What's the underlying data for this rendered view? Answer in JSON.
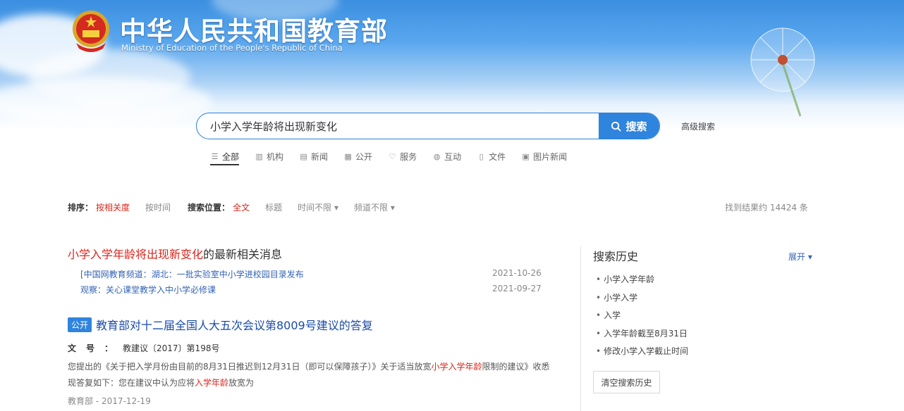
{
  "header": {
    "title_cn": "中华人民共和国教育部",
    "title_en": "Ministry of Education of the People's Republic of China",
    "logo_icon": "national-emblem-icon"
  },
  "search": {
    "value": "小学入学年龄将出现新变化",
    "button_label": "搜索",
    "advanced_label": "高级搜索"
  },
  "tabs": [
    {
      "label": "全部",
      "icon": "list-icon",
      "active": true
    },
    {
      "label": "机构",
      "icon": "building-icon",
      "active": false
    },
    {
      "label": "新闻",
      "icon": "news-icon",
      "active": false
    },
    {
      "label": "公开",
      "icon": "document-icon",
      "active": false
    },
    {
      "label": "服务",
      "icon": "heart-icon",
      "active": false
    },
    {
      "label": "互动",
      "icon": "chat-icon",
      "active": false
    },
    {
      "label": "文件",
      "icon": "file-icon",
      "active": false
    },
    {
      "label": "图片新闻",
      "icon": "image-icon",
      "active": false
    }
  ],
  "filter": {
    "sort_label": "排序：",
    "sort_relevance": "按相关度",
    "sort_time": "按时间",
    "position_label": "搜索位置：",
    "position_full": "全文",
    "position_title": "标题",
    "time_any": "时间不限",
    "channel_any": "频道不限",
    "total": "找到结果约 14424 条"
  },
  "news": {
    "head_keyword": "小学入学年龄将出现新变化",
    "head_suffix": "的最新相关消息",
    "items": [
      {
        "prefix": "[中国网教育频道：",
        "text": "湖北：一批实验室中小学进校园目录发布",
        "date": "2021-10-26"
      },
      {
        "prefix": "观察：",
        "text": "关心课堂教学入中小学必修课",
        "date": "2021-09-27"
      }
    ]
  },
  "result": {
    "badge": "公开",
    "title": "教育部对十二届全国人大五次会议第8009号建议的答复",
    "docno_label": "文号：",
    "docno_value": "教建议〔2017〕第198号",
    "snippet_line1_a": "您提出的《关于把入学月份由目前的8月31日推迟到12月31日（即可以保障孩子）》关于适当放宽",
    "snippet_line1_kw": "小学入学年龄",
    "snippet_line1_b": "限制的建议》收悉",
    "snippet_line2_a": "现答复如下：您在建议中认为应将",
    "snippet_line2_kw": "入学年龄",
    "snippet_line2_b": "放宽为",
    "source": "教育部 - 2017-12-19"
  },
  "history": {
    "title": "搜索历史",
    "toggle_label": "展开",
    "items": [
      "小学入学年龄",
      "小学入学",
      "入学",
      "入学年龄截至8月31日",
      "修改小学入学截止时间"
    ],
    "clear_label": "清空搜索历史"
  }
}
